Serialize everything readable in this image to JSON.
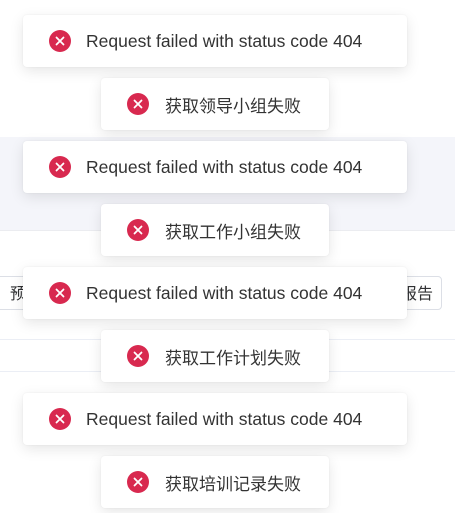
{
  "theme": {
    "error_color": "#d8294f",
    "text_color": "#333333"
  },
  "background": {
    "left_button_label": "预",
    "right_button_label": "报告"
  },
  "toasts": [
    {
      "icon": "error-icon",
      "message": "Request failed with status code 404"
    },
    {
      "icon": "error-icon",
      "message": "获取领导小组失败"
    },
    {
      "icon": "error-icon",
      "message": "Request failed with status code 404"
    },
    {
      "icon": "error-icon",
      "message": "获取工作小组失败"
    },
    {
      "icon": "error-icon",
      "message": "Request failed with status code 404"
    },
    {
      "icon": "error-icon",
      "message": "获取工作计划失败"
    },
    {
      "icon": "error-icon",
      "message": "Request failed with status code 404"
    },
    {
      "icon": "error-icon",
      "message": "获取培训记录失败"
    }
  ]
}
